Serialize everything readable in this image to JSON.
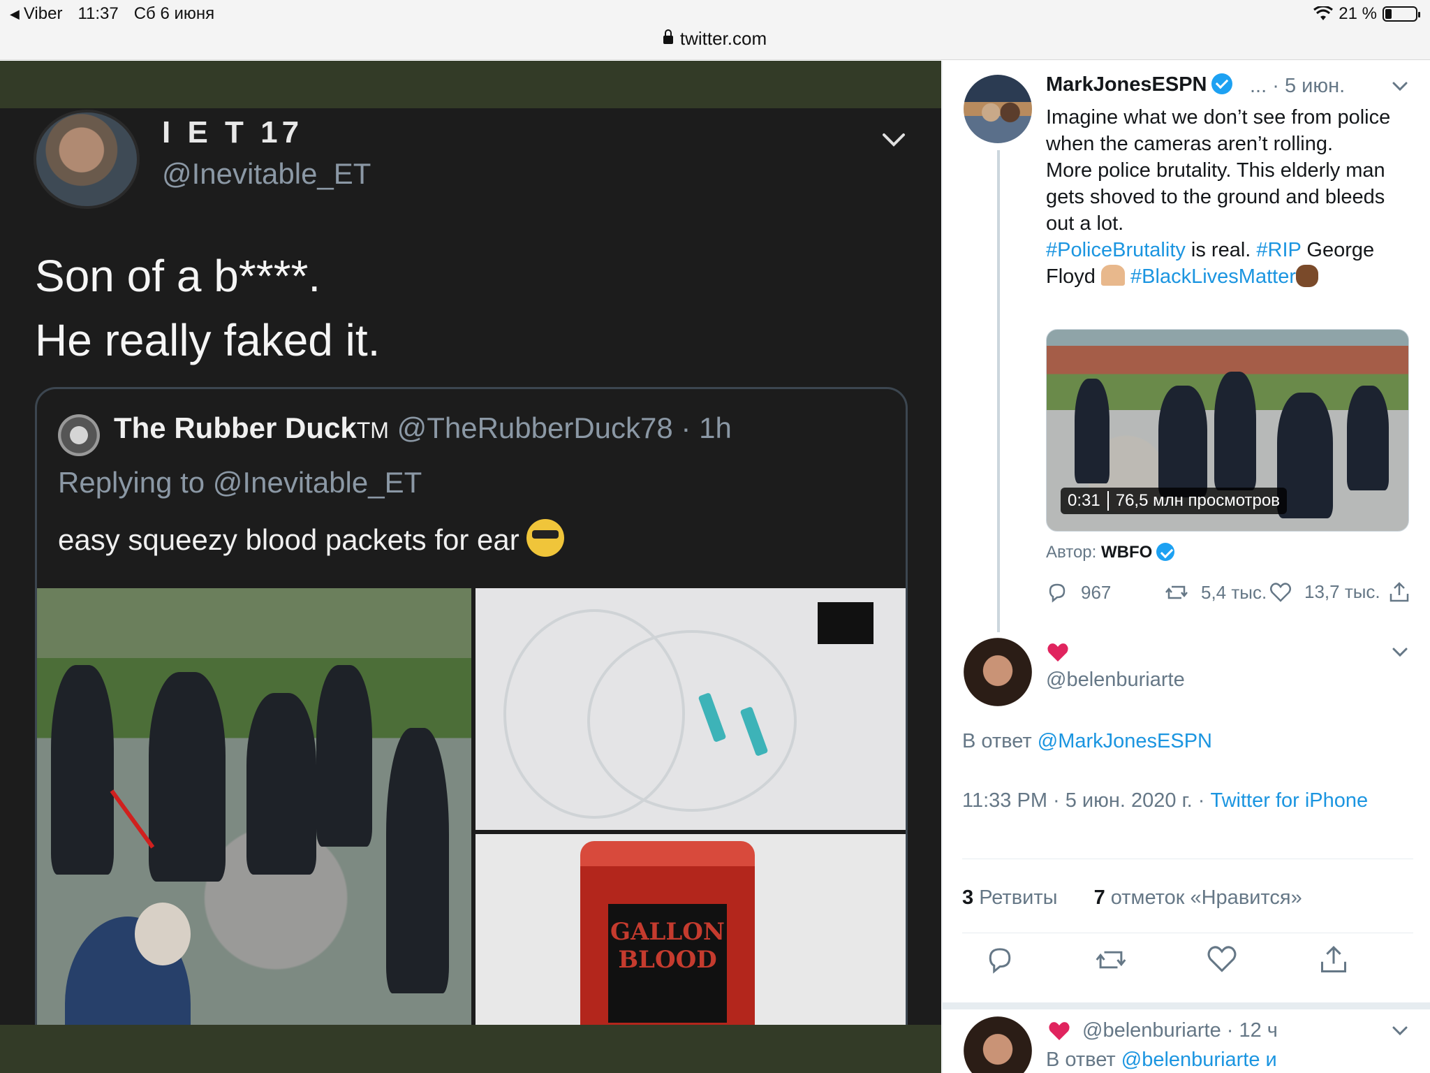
{
  "status_bar": {
    "back_app": "Viber",
    "time": "11:37",
    "date": "Сб 6 июня",
    "battery": "21 %",
    "battery_level": 0.21,
    "url": "twitter.com"
  },
  "embedded_screenshot": {
    "author_name": "I E T 17",
    "author_handle": "@Inevitable_ET",
    "tweet_text": "Son of a b****.\nHe really faked it.",
    "quoted": {
      "name": "The Rubber Duck",
      "name_suffix": "TM",
      "handle_time": "@TheRubberDuck78 · 1h",
      "replying_to": "Replying to @Inevitable_ET",
      "text": "easy squeezy blood packets for ear",
      "jar_label": "GALLON BLOOD"
    }
  },
  "main_tweet": {
    "author": "MarkJonesESPN",
    "meta": "... · 5 июн.",
    "body": {
      "line1": "Imagine what we don’t see from police when the cameras aren’t rolling.",
      "line2": "More police brutality. This elderly man gets shoved to the ground and bleeds out a lot.",
      "hashtag1": "#PoliceBrutality",
      "mid1": " is real. ",
      "hashtag2": "#RIP",
      "mid2": " George Floyd ",
      "hashtag3": "#BlackLivesMatter"
    },
    "video": {
      "duration": "0:31",
      "views": "76,5 млн просмотров"
    },
    "author_label": "Автор:",
    "author_source": "WBFO",
    "replies": "967",
    "retweets": "5,4 тыс.",
    "likes": "13,7 тыс."
  },
  "reply_tweet": {
    "handle": "@belenburiarte",
    "replying_label": "В ответ",
    "replying_handle": "@MarkJonesESPN",
    "timestamp": "11:33 PM · 5 июн. 2020 г. ·",
    "source": "Twitter for iPhone",
    "retweets_count": "3",
    "retweets_label": "Ретвиты",
    "likes_count": "7",
    "likes_label": "отметок «Нравится»"
  },
  "next_tweet": {
    "handle_time": "@belenburiarte · 12 ч",
    "replying_label": "В ответ",
    "replying_handle": "@belenburiarte и"
  },
  "colors": {
    "link": "#1b95e0",
    "muted": "#657786",
    "heart": "#e0245e",
    "olive": "#333b27"
  }
}
